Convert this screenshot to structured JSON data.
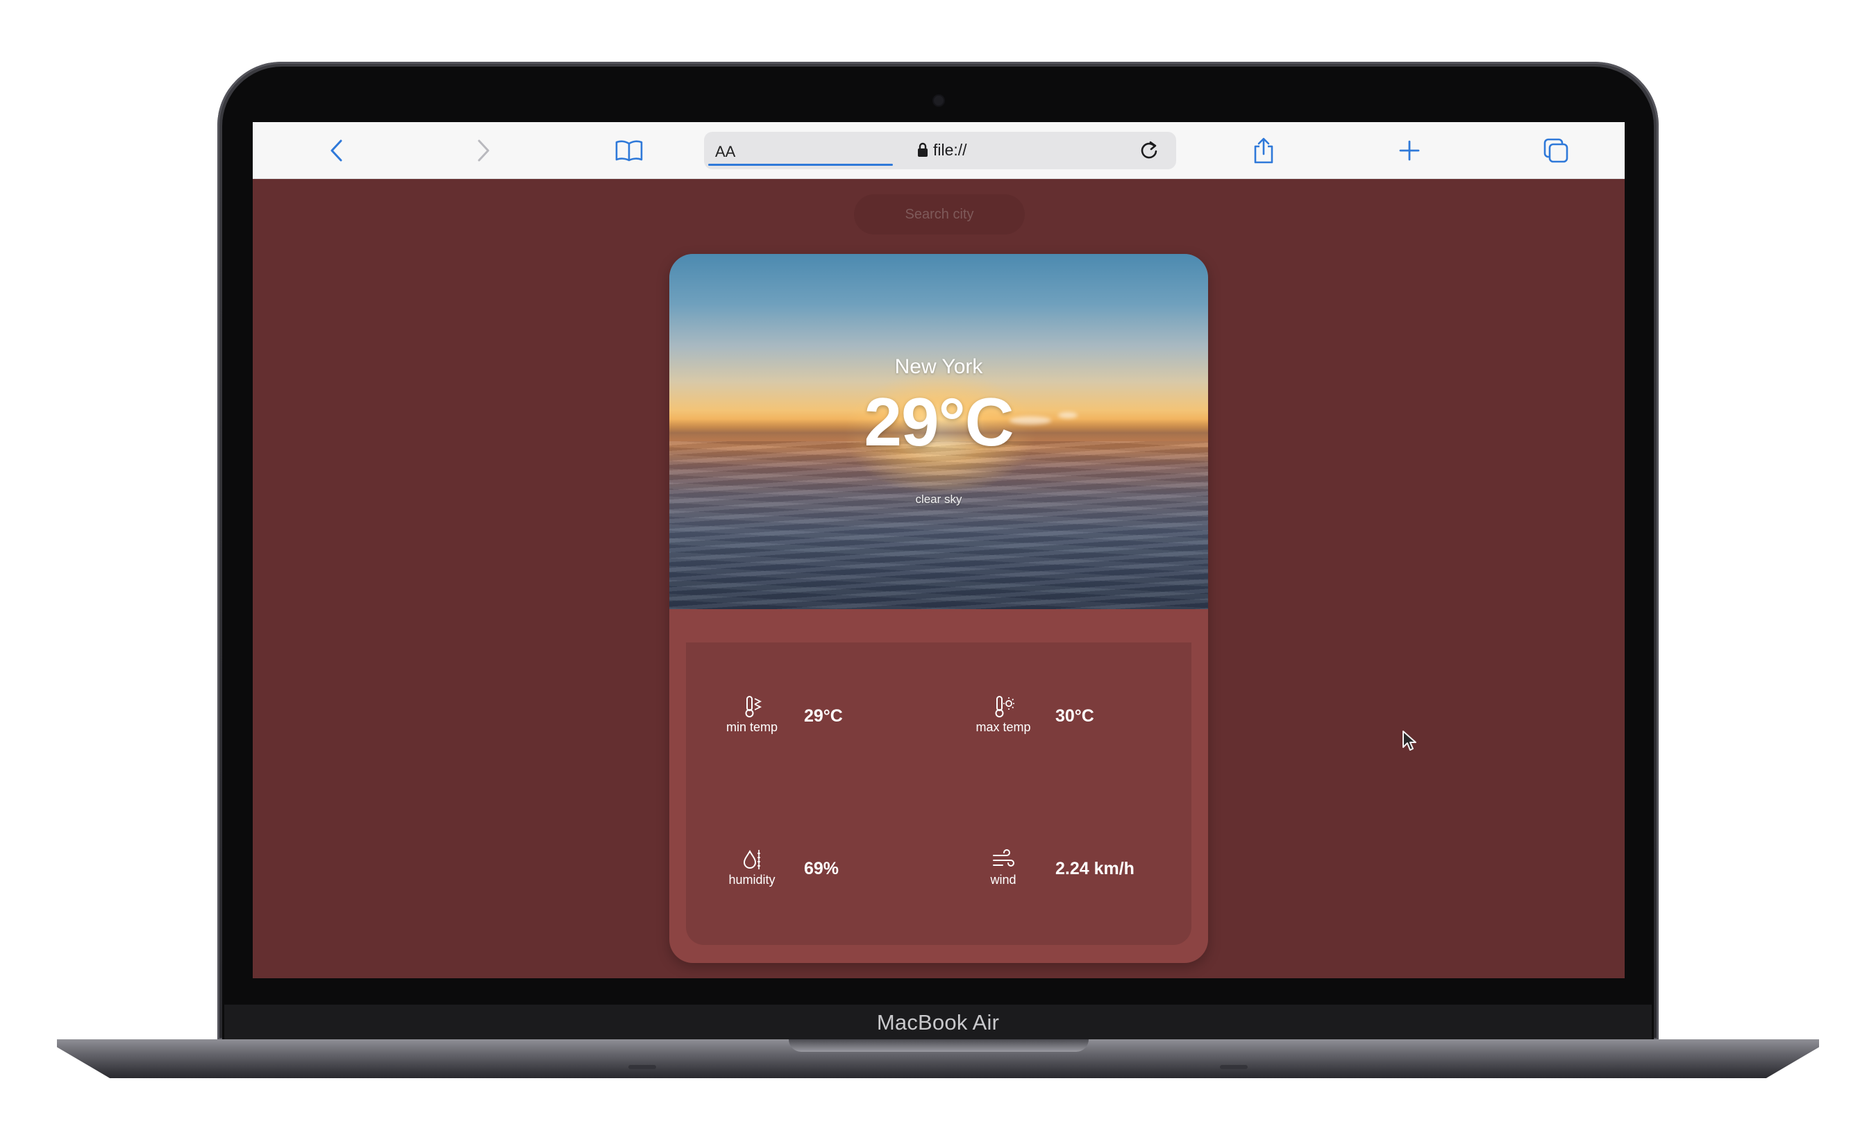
{
  "device": {
    "label": "MacBook Air"
  },
  "browser": {
    "text_size_label": "AA",
    "url": "file://"
  },
  "page": {
    "search": {
      "placeholder": "Search city"
    },
    "weather": {
      "city": "New York",
      "temperature": "29°C",
      "description": "clear sky"
    },
    "stats": [
      {
        "label": "min temp",
        "value": "29°C",
        "icon": "thermometer-cold-icon"
      },
      {
        "label": "max temp",
        "value": "30°C",
        "icon": "thermometer-sun-icon"
      },
      {
        "label": "humidity",
        "value": "69%",
        "icon": "humidity-icon"
      },
      {
        "label": "wind",
        "value": "2.24 km/h",
        "icon": "wind-icon"
      }
    ]
  },
  "colors": {
    "page_background": "#642f30",
    "card_background": "#8c4443",
    "stats_background": "#7c3c3c",
    "browser_accent": "#2f79d9"
  }
}
